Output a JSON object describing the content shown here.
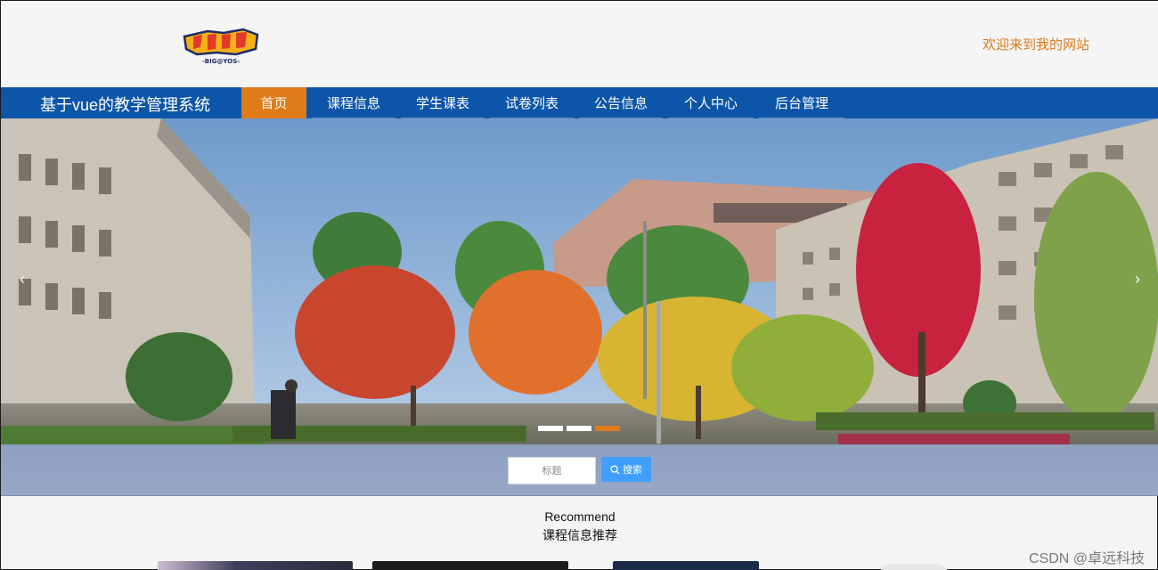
{
  "header": {
    "logo_text": "BIG@YOS",
    "welcome": "欢迎来到我的网站"
  },
  "navbar": {
    "site_title": "基于vue的教学管理系统",
    "items": [
      {
        "label": "首页",
        "active": true
      },
      {
        "label": "课程信息",
        "active": false
      },
      {
        "label": "学生课表",
        "active": false
      },
      {
        "label": "试卷列表",
        "active": false
      },
      {
        "label": "公告信息",
        "active": false
      },
      {
        "label": "个人中心",
        "active": false
      },
      {
        "label": "后台管理",
        "active": false
      }
    ]
  },
  "carousel": {
    "prev_icon": "chevron-left-icon",
    "next_icon": "chevron-right-icon",
    "slide_count": 3,
    "active_index": 2
  },
  "search": {
    "placeholder": "标题",
    "button_label": "搜索",
    "button_icon": "search-icon"
  },
  "recommend": {
    "title_en": "Recommend",
    "title_cn": "课程信息推荐"
  },
  "watermark": "CSDN @卓远科技",
  "colors": {
    "nav_bg": "#0c55a8",
    "accent_orange": "#e07b1a",
    "welcome_text": "#d9791b",
    "search_button": "#409eff"
  }
}
